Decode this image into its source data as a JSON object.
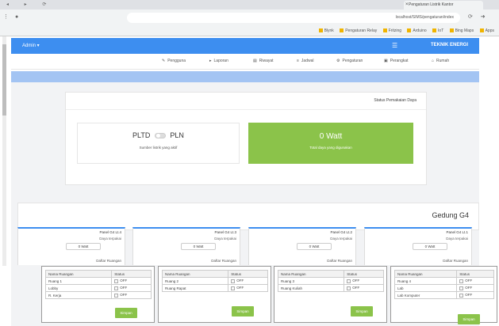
{
  "browser": {
    "tab_title": "Pengaturan Listrik Kantor",
    "url": "localhost/SIMS/pengaturan/index",
    "bookmarks": [
      "Apps",
      "Bing Maps",
      "IoT",
      "Arduino",
      "Fritzing",
      "Pengaturan Relay",
      "Blynk"
    ]
  },
  "app": {
    "brand": "TEKNIK ENERGI",
    "user": "Admin",
    "menu": [
      "Rumah",
      "Perangkat",
      "Pengaturan",
      "Jadwal",
      "Riwayat",
      "Laporan",
      "Pengguna"
    ]
  },
  "summary": {
    "title": "Status Pemakaian Daya",
    "power_value": "0 Watt",
    "power_sub": "Total daya yang digunakan",
    "source_left": "PLTD",
    "source_right": "PLN",
    "source_sub": "Sumber listrik yang aktif"
  },
  "building": {
    "title": "Gedung G4",
    "panels": [
      {
        "title": "Panel G4 Lt.1",
        "label": "Daya terpakai",
        "value": "0 Watt",
        "list_label": "Daftar Ruangan"
      },
      {
        "title": "Panel G4 Lt.2",
        "label": "Daya terpakai",
        "value": "0 Watt",
        "list_label": "Daftar Ruangan"
      },
      {
        "title": "Panel G4 Lt.3",
        "label": "Daya terpakai",
        "value": "0 Watt",
        "list_label": "Daftar Ruangan"
      },
      {
        "title": "Panel G4 Lt.4",
        "label": "Daya terpakai",
        "value": "0 Watt",
        "list_label": "Daftar Ruangan"
      }
    ]
  },
  "tables": [
    {
      "col_name": "Nama Ruangan",
      "col_status": "Status",
      "rows": [
        {
          "name": "Ruang 1",
          "status": "OFF"
        },
        {
          "name": "Lobby",
          "status": "OFF"
        },
        {
          "name": "R. Kerja",
          "status": "OFF"
        }
      ],
      "button": "Simpan"
    },
    {
      "col_name": "Nama Ruangan",
      "col_status": "Status",
      "rows": [
        {
          "name": "Ruang 2",
          "status": "OFF"
        },
        {
          "name": "Ruang Rapat",
          "status": "OFF"
        }
      ],
      "button": "Simpan"
    },
    {
      "col_name": "Nama Ruangan",
      "col_status": "Status",
      "rows": [
        {
          "name": "Ruang 3",
          "status": "OFF"
        },
        {
          "name": "Ruang Kuliah",
          "status": "OFF"
        }
      ],
      "button": "Simpan"
    },
    {
      "col_name": "Nama Ruangan",
      "col_status": "Status",
      "rows": [
        {
          "name": "Ruang 4",
          "status": "OFF"
        },
        {
          "name": "Lab",
          "status": "OFF"
        },
        {
          "name": "Lab Komputer",
          "status": "OFF"
        }
      ],
      "button": "Simpan"
    }
  ],
  "colors": {
    "accent": "#3d8ef0",
    "success": "#8bc34a",
    "stripe": "#a3c4f3"
  }
}
